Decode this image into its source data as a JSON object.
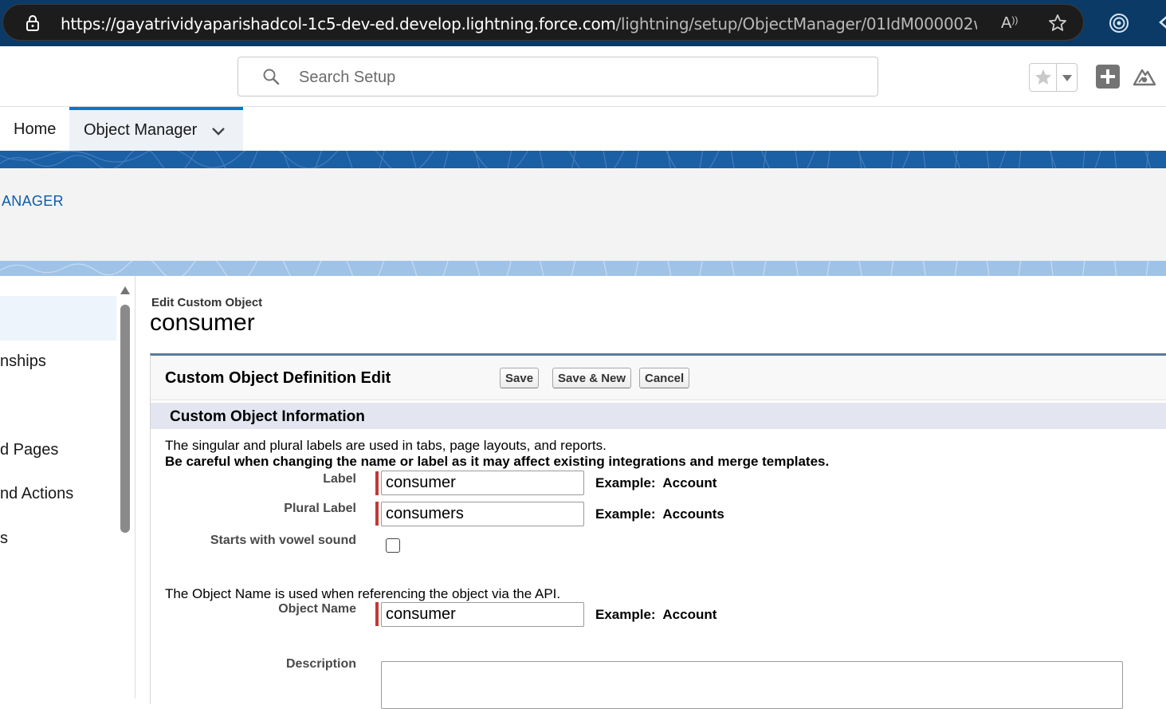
{
  "browser": {
    "url_host": "https://gayatrividyaparishadcol-1c5-dev-ed.develop.lightning.force.com",
    "url_path": "/lightning/setup/ObjectManager/01IdM000002wy..."
  },
  "header": {
    "search_placeholder": "Search Setup"
  },
  "nav": {
    "home": "Home",
    "object_manager": "Object Manager"
  },
  "breadcrumb": "ANAGER",
  "sidebar": {
    "items": [
      "nships",
      "d Pages",
      "nd Actions",
      "s"
    ]
  },
  "page": {
    "kicker": "Edit Custom Object",
    "title": "consumer"
  },
  "panel": {
    "title": "Custom Object Definition Edit",
    "buttons": {
      "save": "Save",
      "save_new": "Save & New",
      "cancel": "Cancel"
    },
    "section_title": "Custom Object Information",
    "help_text_1": "The singular and plural labels are used in tabs, page layouts, and reports.",
    "help_text_2": "Be careful when changing the name or label as it may affect existing integrations and merge templates.",
    "help_text_3": "The Object Name is used when referencing the object via the API.",
    "fields": {
      "label": {
        "label": "Label",
        "value": "consumer",
        "example": "Example:  Account"
      },
      "plural_label": {
        "label": "Plural Label",
        "value": "consumers",
        "example": "Example:  Accounts"
      },
      "vowel": {
        "label": "Starts with vowel sound",
        "checked": false
      },
      "object_name": {
        "label": "Object Name",
        "value": "consumer",
        "example": "Example:  Account"
      },
      "description": {
        "label": "Description",
        "value": ""
      }
    }
  }
}
